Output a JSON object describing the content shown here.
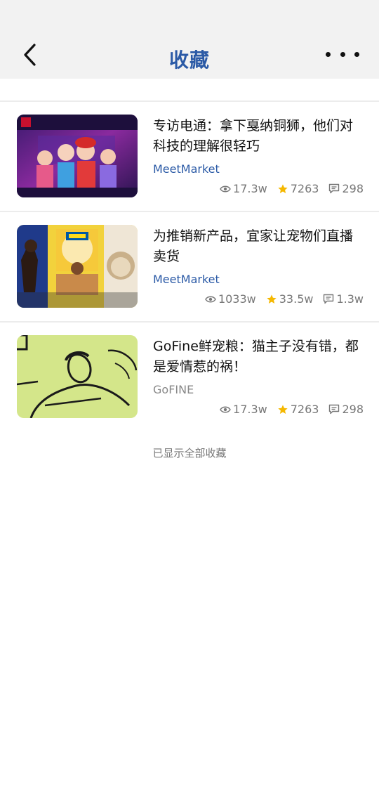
{
  "header": {
    "title": "收藏"
  },
  "articles": [
    {
      "title": "专访电通：拿下戛纳铜狮，他们对科技的理解很轻巧",
      "source": "MeetMarket",
      "views": "17.3w",
      "stars": "7263",
      "comments": "298",
      "thumb_desc": "kfc-anime-characters"
    },
    {
      "title": "为推销新产品，宜家让宠物们直播卖货",
      "source": "MeetMarket",
      "views": "1033w",
      "stars": "33.5w",
      "comments": "1.3w",
      "thumb_desc": "ikea-pets"
    },
    {
      "title": "GoFine鲜宠粮：猫主子没有错，都是爱情惹的祸！",
      "source": "GoFINE",
      "views": "17.3w",
      "stars": "7263",
      "comments": "298",
      "thumb_desc": "gofine-illustration"
    }
  ],
  "footer": {
    "note": "已显示全部收藏"
  },
  "colors": {
    "accent": "#2b5aa6",
    "star": "#f5b800",
    "header_bg": "#f2f2f2"
  }
}
